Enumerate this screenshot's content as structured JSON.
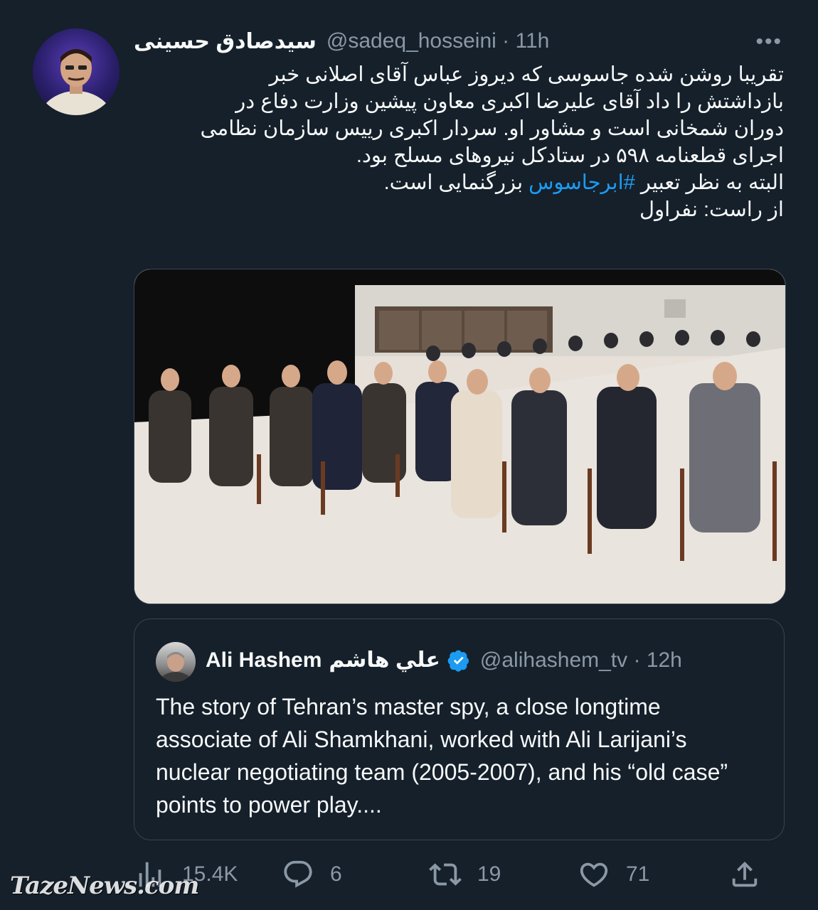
{
  "tweet": {
    "display_name": "سیدصادق حسینی",
    "handle": "@sadeq_hosseini",
    "time": "11h",
    "more_label": "•••",
    "lines": [
      "تقریبا روشن شده جاسوسی که دیروز عباس آقای اصلانی خبر",
      "بازداشتش را داد آقای علیرضا اکبری معاون پیشین وزارت دفاع در",
      "دوران شمخانی است و مشاور او. سردار اکبری رییس سازمان نظامی",
      "اجرای قطعنامه ۵۹۸ در ستادکل نیروهای مسلح بود."
    ],
    "line5_before": "البته به نظر تعبیر ",
    "hashtag": "#ابرجاسوس",
    "line5_after": " بزرگنمایی است.",
    "line6": "از راست: نفراول"
  },
  "quote": {
    "name_en": "Ali Hashem",
    "name_ar": "علي هاشم",
    "handle": "@alihashem_tv",
    "time": "12h",
    "text": "The story of Tehran’s master spy, a close longtime associate of Ali Shamkhani, worked with Ali Larijani’s nuclear negotiating team (2005-2007), and his “old case” points to power play...."
  },
  "actions": {
    "views": "15.4K",
    "replies": "6",
    "retweets": "19",
    "likes": "71"
  },
  "watermark": "TazeNews.com",
  "colors": {
    "background": "#15202b",
    "text": "#f7f9f9",
    "muted": "#8b98a5",
    "accent": "#1d9bf0",
    "border": "#38444d"
  },
  "icons": [
    "views-icon",
    "reply-icon",
    "retweet-icon",
    "like-icon",
    "share-icon",
    "verified-icon",
    "more-icon"
  ]
}
